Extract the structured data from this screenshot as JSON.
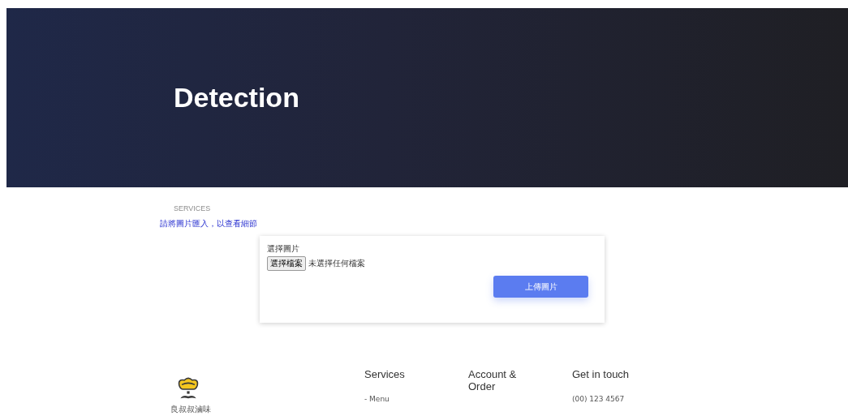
{
  "hero": {
    "title": "Detection"
  },
  "section": {
    "eyebrow": "SERVICES",
    "instruction": "請將圖片匯入，以查看細節"
  },
  "upload_form": {
    "label": "選擇圖片",
    "file_button": "選擇檔案",
    "file_status": "未選擇任何檔案",
    "submit": "上傳圖片"
  },
  "footer": {
    "brand": "良叔叔滷味",
    "columns": [
      {
        "heading": "Services",
        "items": [
          "- Menu"
        ]
      },
      {
        "heading": "Account & Order"
      },
      {
        "heading": "Get in touch",
        "items": [
          "(00) 123 4567"
        ]
      }
    ]
  }
}
